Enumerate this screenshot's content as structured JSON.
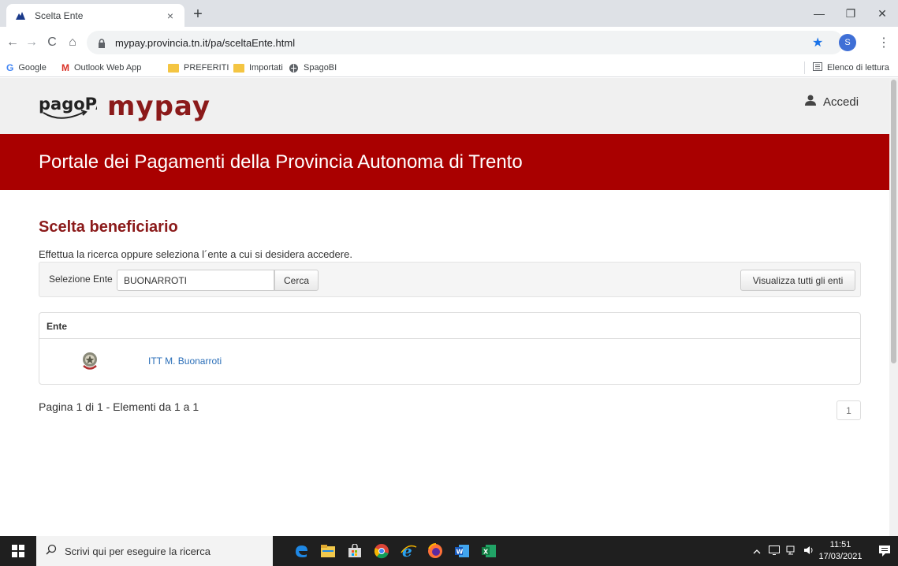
{
  "browser": {
    "tab_title": "Scelta Ente",
    "tab_close": "×",
    "new_tab": "+",
    "window": {
      "minimize": "—",
      "restore": "❐",
      "close": "✕"
    },
    "url": "mypay.provincia.tn.it/pa/sceltaEnte.html",
    "profile_initial": "S",
    "nav": {
      "back": "←",
      "forward": "→",
      "reload": "C",
      "home": "⌂",
      "star": "★",
      "menu": "⋮"
    },
    "bookmarks": [
      {
        "label": "Google",
        "icon": "google-icon"
      },
      {
        "label": "Outlook Web App",
        "icon": "gmail-icon"
      },
      {
        "label": "PREFERITI",
        "icon": "folder-icon"
      },
      {
        "label": "Importati",
        "icon": "folder-icon"
      },
      {
        "label": "SpagoBI",
        "icon": "globe-icon"
      }
    ],
    "reading_list": "Elenco di lettura"
  },
  "header": {
    "logo_pagopa": "pagoPA",
    "logo_mypay": "mypay",
    "login_label": "Accedi"
  },
  "banner": {
    "title": "Portale dei Pagamenti della Provincia Autonoma di Trento"
  },
  "main": {
    "section_title": "Scelta beneficiario",
    "hint": "Effettua la ricerca oppure seleziona l´ente a cui si desidera accedere.",
    "search": {
      "label": "Selezione Ente",
      "value": "BUONARROTI",
      "search_button": "Cerca",
      "show_all_button": "Visualizza tutti gli enti"
    },
    "table": {
      "header": "Ente",
      "rows": [
        {
          "name": "ITT M. Buonarroti",
          "icon": "emblem-icon"
        }
      ]
    },
    "pagination": {
      "info": "Pagina 1 di 1 - Elementi da 1 a 1",
      "current_page": "1"
    }
  },
  "taskbar": {
    "search_placeholder": "Scrivi qui per eseguire la ricerca",
    "apps": [
      "edge-legacy-icon",
      "file-explorer-icon",
      "store-icon",
      "chrome-icon",
      "internet-explorer-icon",
      "firefox-icon",
      "word-icon",
      "excel-icon"
    ],
    "time": "11:51",
    "date": "17/03/2021"
  },
  "colors": {
    "brand_red": "#a90000",
    "title_red": "#8b1a1a",
    "link_blue": "#2a6eb8"
  }
}
